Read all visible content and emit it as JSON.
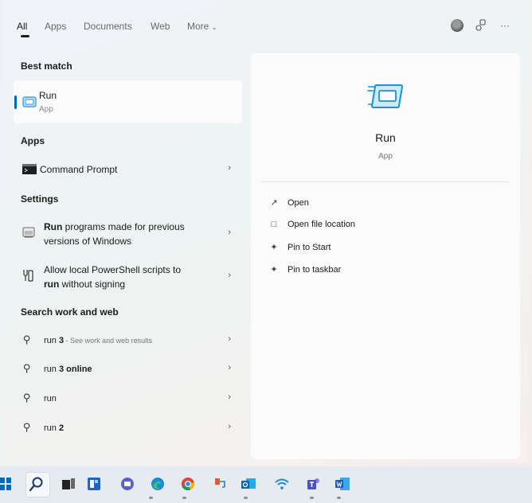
{
  "tabs": {
    "all": "All",
    "apps": "Apps",
    "documents": "Documents",
    "web": "Web",
    "more": "More"
  },
  "header_icons": {
    "avatar": "avatar",
    "connect": "connected-devices-icon",
    "more": "···"
  },
  "left": {
    "best_match_heading": "Best match",
    "best_match": {
      "title": "Run",
      "type": "App"
    },
    "apps_heading": "Apps",
    "apps": [
      {
        "label": "Command Prompt",
        "icon": "command-prompt-icon"
      }
    ],
    "settings_heading": "Settings",
    "settings": [
      {
        "bold": "Run",
        "rest": " programs made for previous",
        "line2": "versions of Windows"
      },
      {
        "line1": "Allow local PowerShell scripts to",
        "bold": "run",
        "rest": " without signing"
      }
    ],
    "web_heading": "Search work and web",
    "web": [
      {
        "normal": "run ",
        "bold": "3",
        "hint": " - See work and web results"
      },
      {
        "normal": "run ",
        "bold": "3 online",
        "hint": ""
      },
      {
        "normal": "run",
        "bold": "",
        "hint": ""
      },
      {
        "normal": "run ",
        "bold": "2",
        "hint": ""
      }
    ]
  },
  "detail": {
    "title": "Run",
    "type": "App",
    "actions": [
      {
        "label": "Open",
        "icon": "open-external-icon"
      },
      {
        "label": "Open file location",
        "icon": "folder-icon"
      },
      {
        "label": "Pin to Start",
        "icon": "pin-icon"
      },
      {
        "label": "Pin to taskbar",
        "icon": "pin-icon"
      }
    ]
  },
  "taskbar": {
    "icons": [
      "start-icon",
      "search-icon",
      "task-view-icon",
      "widgets-icon",
      "chat-icon",
      "edge-icon",
      "chrome-icon",
      "remote-icon",
      "outlook-icon",
      "wifi-icon",
      "teams-icon",
      "word-icon"
    ],
    "accent": "#0067c0"
  }
}
